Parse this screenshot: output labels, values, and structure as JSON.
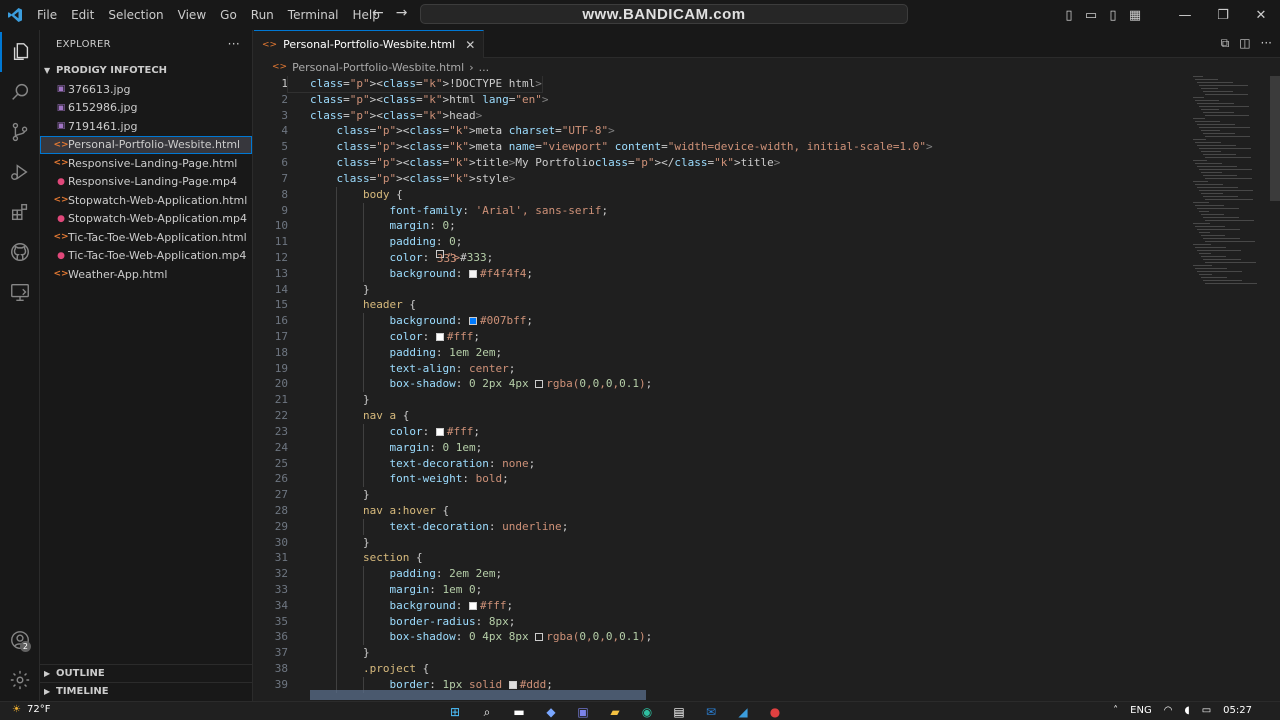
{
  "titlebar": {
    "menu": [
      "File",
      "Edit",
      "Selection",
      "View",
      "Go",
      "Run",
      "Terminal",
      "Help"
    ],
    "search_text": "www.BANDICAM.com"
  },
  "explorer": {
    "title": "EXPLORER",
    "more": "···",
    "folder": "PRODIGY INFOTECH",
    "files": [
      {
        "name": "376613.jpg",
        "type": "img"
      },
      {
        "name": "6152986.jpg",
        "type": "img"
      },
      {
        "name": "7191461.jpg",
        "type": "img"
      },
      {
        "name": "Personal-Portfolio-Wesbite.html",
        "type": "html",
        "selected": true
      },
      {
        "name": "Responsive-Landing-Page.html",
        "type": "html"
      },
      {
        "name": "Responsive-Landing-Page.mp4",
        "type": "mp4"
      },
      {
        "name": "Stopwatch-Web-Application.html",
        "type": "html"
      },
      {
        "name": "Stopwatch-Web-Application.mp4",
        "type": "mp4"
      },
      {
        "name": "Tic-Tac-Toe-Web-Application.html",
        "type": "html"
      },
      {
        "name": "Tic-Tac-Toe-Web-Application.mp4",
        "type": "mp4"
      },
      {
        "name": "Weather-App.html",
        "type": "html"
      }
    ],
    "outline": "OUTLINE",
    "timeline": "TIMELINE"
  },
  "editor": {
    "tab_label": "Personal-Portfolio-Wesbite.html",
    "breadcrumb_file": "Personal-Portfolio-Wesbite.html",
    "breadcrumb_more": "...",
    "current_line": 1,
    "lines": [
      "<!DOCTYPE html>",
      "<html lang=\"en\">",
      "<head>",
      "    <meta charset=\"UTF-8\">",
      "    <meta name=\"viewport\" content=\"width=device-width, initial-scale=1.0\">",
      "    <title>My Portfolio</title>",
      "    <style>",
      "        body {",
      "            font-family: 'Arial', sans-serif;",
      "            margin: 0;",
      "            padding: 0;",
      "            color: #333;",
      "            background: #f4f4f4;",
      "        }",
      "        header {",
      "            background: #007bff;",
      "            color: #fff;",
      "            padding: 1em 2em;",
      "            text-align: center;",
      "            box-shadow: 0 2px 4px rgba(0,0,0,0.1);",
      "        }",
      "        nav a {",
      "            color: #fff;",
      "            margin: 0 1em;",
      "            text-decoration: none;",
      "            font-weight: bold;",
      "        }",
      "        nav a:hover {",
      "            text-decoration: underline;",
      "        }",
      "        section {",
      "            padding: 2em 2em;",
      "            margin: 1em 0;",
      "            background: #fff;",
      "            border-radius: 8px;",
      "            box-shadow: 0 4px 8px rgba(0,0,0,0.1);",
      "        }",
      "        .project {",
      "            border: 1px solid #ddd;"
    ]
  },
  "taskbar": {
    "weather": "72°F",
    "lang": "ENG",
    "time": "05:27"
  },
  "colors": {
    "accent": "#0078d4",
    "html_icon": "#e37933",
    "image_icon": "#a074c4",
    "video_icon": "#e0487a"
  }
}
